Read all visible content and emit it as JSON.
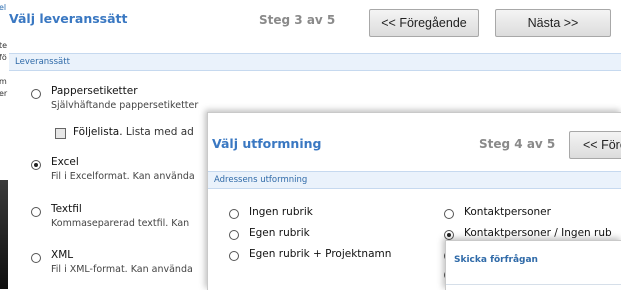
{
  "edge": [
    "el",
    "te",
    "fö",
    "m",
    "er"
  ],
  "win1": {
    "title": "Välj leveranssätt",
    "step": "Steg 3 av 5",
    "prev_label": "<< Föregående",
    "next_label": "Nästa >>",
    "section": "Leveranssätt",
    "options": [
      {
        "label": "Pappersetiketter",
        "desc": "Självhäftande pappersetiketter",
        "selected": false
      },
      {
        "label": "Excel",
        "desc": "Fil i Excelformat. Kan använda",
        "selected": true
      },
      {
        "label": "Textfil",
        "desc": "Kommaseparerad textfil. Kan",
        "selected": false
      },
      {
        "label": "XML",
        "desc": "Fil i XML-format. Kan använda",
        "selected": false
      }
    ],
    "checkbox": {
      "label": "Följelista.",
      "desc": "Lista med ad",
      "checked": false
    }
  },
  "win2": {
    "title": "Välj utformning",
    "step": "Steg 4 av 5",
    "prev_label": "<< Före",
    "section": "Adressens utformning",
    "left_options": [
      {
        "label": "Ingen rubrik",
        "selected": false
      },
      {
        "label": "Egen rubrik",
        "selected": false
      },
      {
        "label": "Egen rubrik + Projektnamn",
        "selected": false
      }
    ],
    "right_options": [
      {
        "label": "Kontaktpersoner",
        "selected": false
      },
      {
        "label": "Kontaktpersoner / Ingen rub",
        "selected": true
      }
    ]
  },
  "win3": {
    "title": "Skicka förfrågan"
  }
}
